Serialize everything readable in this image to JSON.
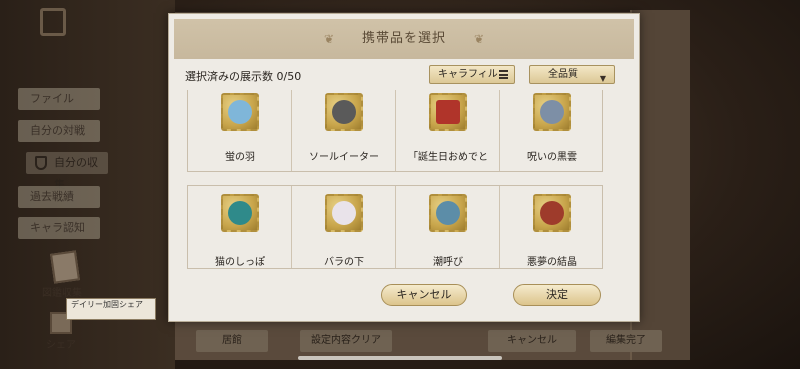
{
  "background": {
    "menu": [
      {
        "label": "ファイル",
        "top": 0
      },
      {
        "label": "自分の対戦"
      },
      {
        "label": "自分の収集"
      },
      {
        "label": "過去戦績"
      },
      {
        "label": "キャラ認知"
      }
    ],
    "book_label": "図鑑収集",
    "daily_label": "デイリー加固シェア",
    "share_label": "シェア",
    "bottom_buttons": [
      "居館",
      "設定内容クリア",
      "キャンセル",
      "編集完了"
    ]
  },
  "modal": {
    "title": "携帯品を選択",
    "count_label": "選択済みの展示数 0/50",
    "filter_chara": "キャラフィル",
    "filter_quality": "全品質",
    "items_row1": [
      {
        "name": "蛍の羽",
        "color": "#7fb6d9"
      },
      {
        "name": "ソールイーター",
        "color": "#5a5a5a"
      },
      {
        "name": "「誕生日おめでと",
        "color": "#b0342a"
      },
      {
        "name": "呪いの黒雲",
        "color": "#7d8fa6"
      }
    ],
    "items_row2": [
      {
        "name": "猫のしっぽ",
        "color": "#2f8a8a"
      },
      {
        "name": "バラの下",
        "color": "#e9e3ea"
      },
      {
        "name": "潮呼び",
        "color": "#5c8da8"
      },
      {
        "name": "悪夢の結晶",
        "color": "#9e3b2b"
      }
    ],
    "cancel_label": "キャンセル",
    "ok_label": "決定"
  }
}
